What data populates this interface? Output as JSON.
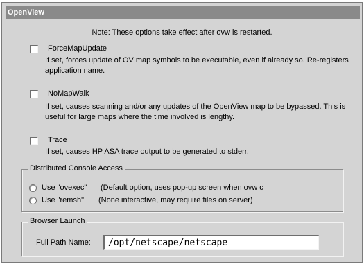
{
  "window": {
    "title": "OpenView"
  },
  "note": "Note: These options take effect after ovw is restarted.",
  "options": [
    {
      "label": "ForceMapUpdate",
      "checked": false,
      "description": "If set, forces update of OV map symbols to be executable, even if already so.  Re-registers application name."
    },
    {
      "label": "NoMapWalk",
      "checked": false,
      "description": "If set, causes scanning and/or any updates of the OpenView map to be bypassed.  This is useful for large maps where the time involved is lengthy."
    },
    {
      "label": "Trace",
      "checked": false,
      "description": "If set, causes HP ASA trace output to be generated to stderr."
    }
  ],
  "distributed": {
    "title": "Distributed Console Access",
    "radios": [
      {
        "label": "Use \"ovexec\"",
        "description": "(Default option, uses pop-up screen when  ovw c",
        "selected": false
      },
      {
        "label": "Use \"remsh\"",
        "description": "(None interactive, may require files on server)",
        "selected": false
      }
    ]
  },
  "browser": {
    "title": "Browser Launch",
    "path_label": "Full Path Name:",
    "path_value": "/opt/netscape/netscape"
  },
  "colors": {
    "panel": "#d4d4d4",
    "titlebar": "#8a8a8a",
    "field": "#ffffff"
  }
}
